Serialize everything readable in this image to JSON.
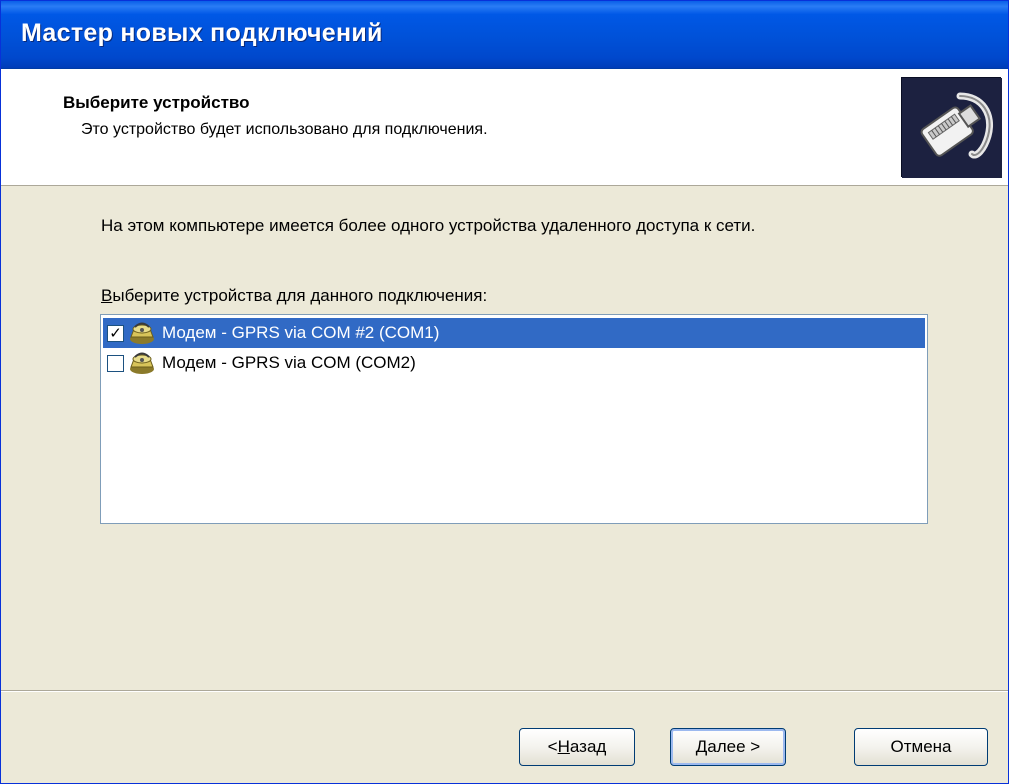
{
  "window": {
    "title": "Мастер новых подключений"
  },
  "header": {
    "title": "Выберите устройство",
    "subtitle": "Это устройство будет использовано для подключения."
  },
  "body": {
    "intro": "На этом компьютере имеется более одного устройства удаленного доступа к сети.",
    "list_label_accel": "В",
    "list_label_rest": "ыберите устройства для данного подключения:",
    "devices": [
      {
        "label": "Модем - GPRS via COM #2 (COM1)",
        "checked": true,
        "selected": true,
        "icon": "modem-icon"
      },
      {
        "label": "Модем - GPRS via COM (COM2)",
        "checked": false,
        "selected": false,
        "icon": "modem-icon"
      }
    ]
  },
  "buttons": {
    "back_prefix": "< ",
    "back_accel": "Н",
    "back_rest": "азад",
    "next_accel": "Д",
    "next_rest": "алее >",
    "cancel": "Отмена"
  },
  "colors": {
    "titlebar": "#0058e6",
    "selection": "#316ac5",
    "face": "#ece9d8"
  }
}
